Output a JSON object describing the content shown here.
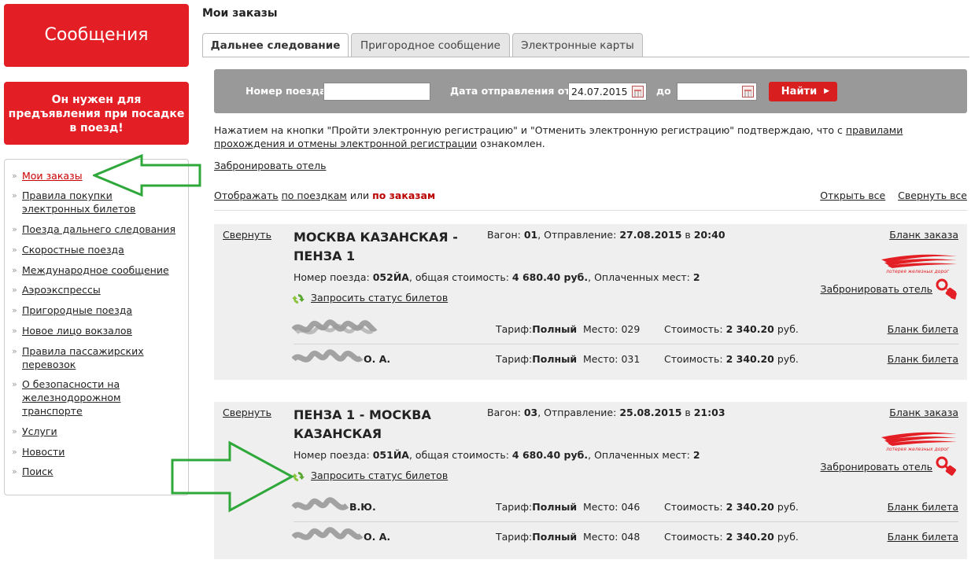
{
  "left": {
    "messages_label": "Сообщения",
    "notice_label": "Он нужен для предъявления при посадке в поезд!",
    "nav": [
      "Мои заказы",
      "Правила покупки электронных билетов",
      "Поезда дальнего следования",
      "Скоростные поезда",
      "Международное сообщение",
      "Аэроэкспрессы",
      "Пригородные поезда",
      "Новое лицо вокзалов",
      "Правила пассажирских перевозок",
      "О безопасности на железнодорожном транспорте",
      "Услуги",
      "Новости",
      "Поиск"
    ]
  },
  "main": {
    "title": "Мои заказы",
    "tabs": [
      "Дальнее следование",
      "Пригородное сообщение",
      "Электронные карты"
    ],
    "search": {
      "train_label": "Номер поезда",
      "train_value": "",
      "date_from_label": "Дата отправления от",
      "date_from_value": "24.07.2015",
      "date_to_label": "до",
      "date_to_value": "",
      "find_label": "Найти"
    },
    "notice": {
      "part1": "Нажатием на кнопки \"Пройти электронную регистрацию\" и \"Отменить электронную регистрацию\" подтверждаю, что с ",
      "link": "правилами прохождения и отмены электронной регистрации",
      "part2": " ознакомлен."
    },
    "book_hotel": "Забронировать отель",
    "view": {
      "show": "Отображать",
      "by_trips": "по поездкам",
      "or": "или",
      "by_orders": "по заказам",
      "open_all": "Открыть все",
      "collapse_all": "Свернуть все"
    },
    "orders": [
      {
        "collapse": "Свернуть",
        "route": "МОСКВА КАЗАНСКАЯ - ПЕНЗА 1",
        "wagon_label": "Вагон:",
        "wagon": "01",
        "departure_label": ", Отправление:",
        "departure_date": "27.08.2015",
        "at": "в",
        "departure_time": "20:40",
        "blank_order": "Бланк заказа",
        "train_label": "Номер поезда:",
        "train": "052ЙА",
        "total_label": ", общая стоимость:",
        "total": "4 680.40 руб.",
        "paid_label": ", Оплаченных мест:",
        "paid": "2",
        "status_label": "Запросить статус билетов",
        "hotel_label": "Забронировать отель",
        "passengers": [
          {
            "name": "",
            "tariff_label": "Тариф:",
            "tariff": "Полный",
            "seat_label": "Место:",
            "seat": "029",
            "cost_label": "Стоимость:",
            "cost": "2 340.20",
            "currency": "руб.",
            "blank": "Бланк билета"
          },
          {
            "name": "О. А.",
            "tariff_label": "Тариф:",
            "tariff": "Полный",
            "seat_label": "Место:",
            "seat": "031",
            "cost_label": "Стоимость:",
            "cost": "2 340.20",
            "currency": "руб.",
            "blank": "Бланк билета"
          }
        ]
      },
      {
        "collapse": "Свернуть",
        "route": "ПЕНЗА 1 - МОСКВА КАЗАНСКАЯ",
        "wagon_label": "Вагон:",
        "wagon": "03",
        "departure_label": ", Отправление:",
        "departure_date": "25.08.2015",
        "at": "в",
        "departure_time": "21:03",
        "blank_order": "Бланк заказа",
        "train_label": "Номер поезда:",
        "train": "051ЙА",
        "total_label": ", общая стоимость:",
        "total": "4 680.40 руб.",
        "paid_label": ", Оплаченных мест:",
        "paid": "2",
        "status_label": "Запросить статус билетов",
        "hotel_label": "Забронировать отель",
        "passengers": [
          {
            "name": "В.Ю.",
            "tariff_label": "Тариф:",
            "tariff": "Полный",
            "seat_label": "Место:",
            "seat": "046",
            "cost_label": "Стоимость:",
            "cost": "2 340.20",
            "currency": "руб.",
            "blank": "Бланк билета"
          },
          {
            "name": "О. А.",
            "tariff_label": "Тариф:",
            "tariff": "Полный",
            "seat_label": "Место:",
            "seat": "048",
            "cost_label": "Стоимость:",
            "cost": "2 340.20",
            "currency": "руб.",
            "blank": "Бланк билета"
          }
        ]
      }
    ]
  },
  "colors": {
    "brand_red": "#e31e24",
    "annotation_green": "#2ea83a",
    "search_bar": "#999999",
    "order_bg": "#efefef"
  }
}
